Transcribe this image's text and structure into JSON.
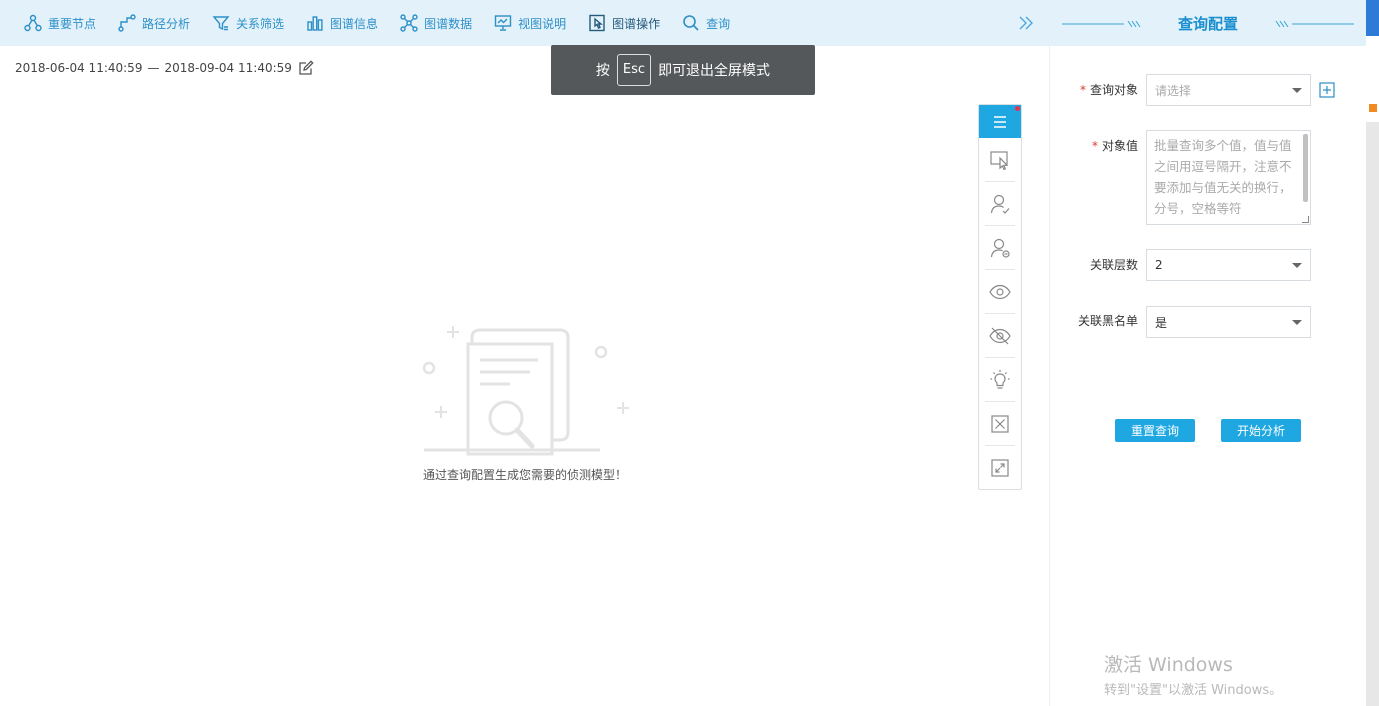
{
  "toolbar": {
    "items": [
      {
        "label": "重要节点",
        "icon": "key-node-icon"
      },
      {
        "label": "路径分析",
        "icon": "path-icon"
      },
      {
        "label": "关系筛选",
        "icon": "filter-icon"
      },
      {
        "label": "图谱信息",
        "icon": "bar-chart-icon"
      },
      {
        "label": "图谱数据",
        "icon": "graph-data-icon"
      },
      {
        "label": "视图说明",
        "icon": "presentation-icon"
      },
      {
        "label": "图谱操作",
        "icon": "graph-operation-icon"
      },
      {
        "label": "查询",
        "icon": "search-icon"
      }
    ],
    "collapse_icon": "double-chevron-right-icon"
  },
  "date_range": {
    "start": "2018-06-04 11:40:59",
    "separator": "—",
    "end": "2018-09-04 11:40:59",
    "edit_icon": "edit-icon"
  },
  "toast": {
    "prefix": "按",
    "key": "Esc",
    "suffix": "即可退出全屏模式"
  },
  "rail": {
    "items": [
      "menu-icon",
      "select-cursor-icon",
      "user-check-icon",
      "user-remove-icon",
      "eye-icon",
      "eye-off-icon",
      "bulb-icon",
      "close-box-icon",
      "collapse-icon"
    ],
    "accent": "#1ea7e1",
    "badge_color": "#e8334a"
  },
  "empty_state": {
    "text": "通过查询配置生成您需要的侦测模型！"
  },
  "panel": {
    "title": "查询配置",
    "fields": {
      "query_object": {
        "label": "查询对象",
        "placeholder": "请选择",
        "required": true
      },
      "object_value": {
        "label": "对象值",
        "placeholder": "批量查询多个值，值与值之间用逗号隔开，注意不要添加与值无关的换行，分号，空格等符",
        "required": true
      },
      "relation_depth": {
        "label": "关联层数",
        "value": "2"
      },
      "relation_blacklist": {
        "label": "关联黑名单",
        "value": "是"
      }
    },
    "reset_label": "重置查询",
    "start_label": "开始分析",
    "required_mark": "*"
  },
  "watermark": {
    "line1": "激活 Windows",
    "line2": "转到\"设置\"以激活 Windows。"
  },
  "colors": {
    "toolbar_bg": "#e3f2fa",
    "accent": "#1ea7e1",
    "link": "#2c8fc8"
  }
}
